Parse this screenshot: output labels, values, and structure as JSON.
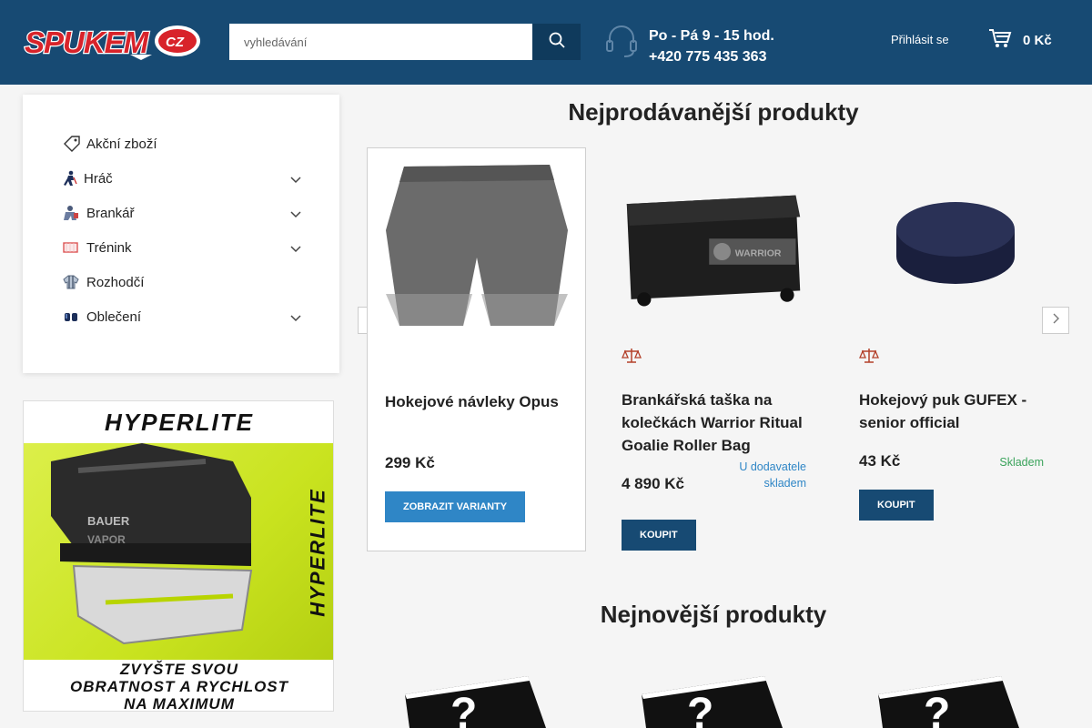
{
  "header": {
    "logo_text": "SPUKEM",
    "logo_badge": "CZ",
    "search": {
      "placeholder": "vyhledávání"
    },
    "contact": {
      "hours": "Po - Pá 9 - 15 hod.",
      "phone": "+420 775 435 363"
    },
    "login_label": "Přihlásit se",
    "cart_total": "0 Kč"
  },
  "sidebar": {
    "items": [
      {
        "label": "Akční zboží",
        "icon": "tag-icon",
        "has_submenu": false
      },
      {
        "label": "Hráč",
        "icon": "hockey-player-icon",
        "has_submenu": true
      },
      {
        "label": "Brankář",
        "icon": "goalie-icon",
        "has_submenu": true
      },
      {
        "label": "Trénink",
        "icon": "goal-net-icon",
        "has_submenu": true
      },
      {
        "label": "Rozhodčí",
        "icon": "referee-jersey-icon",
        "has_submenu": false
      },
      {
        "label": "Oblečení",
        "icon": "clothing-icon",
        "has_submenu": true
      }
    ]
  },
  "banner": {
    "title": "HYPERLITE",
    "side_text": "HYPERLITE",
    "lines": [
      "ZVYŠTE SVOU",
      "OBRATNOST A RYCHLOST",
      "NA MAXIMUM"
    ]
  },
  "bestsellers": {
    "title": "Nejprodávanější produkty",
    "products": [
      {
        "name": "Hokejové návleky Opus",
        "price": "299 Kč",
        "stock": "",
        "button": "ZOBRAZIT VARIANTY"
      },
      {
        "name": "Brankářská taška na kolečkách Warrior Ritual Goalie Roller Bag",
        "price": "4 890 Kč",
        "stock": "U dodavatele skladem",
        "button": "KOUPIT"
      },
      {
        "name": "Hokejový puk GUFEX - senior official",
        "price": "43 Kč",
        "stock": "Skladem",
        "button": "KOUPIT"
      }
    ]
  },
  "newest": {
    "title": "Nejnovější produkty"
  },
  "colors": {
    "header_bg": "#174a73",
    "accent_blue": "#2f86c6",
    "stock_green": "#3aa35b",
    "supplier_blue": "#2f86c6"
  }
}
